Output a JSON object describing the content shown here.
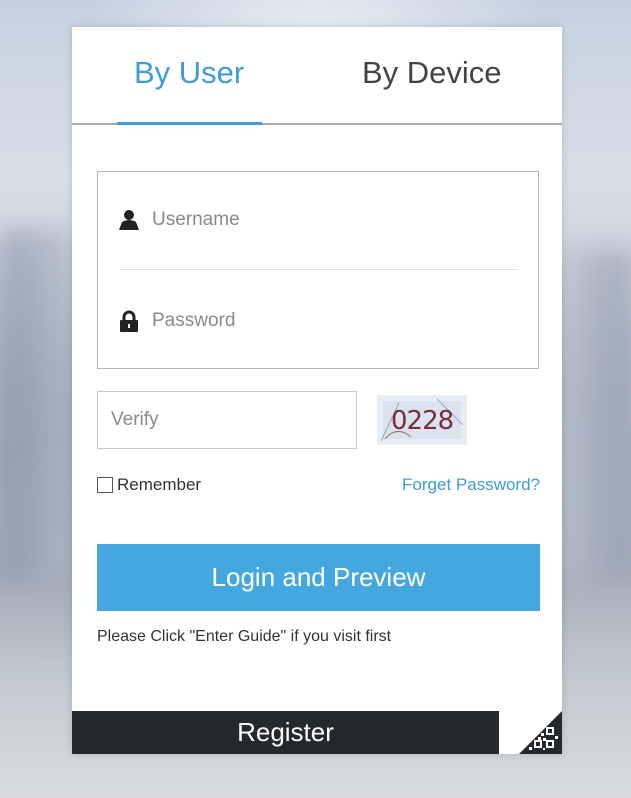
{
  "tabs": [
    {
      "label": "By User",
      "active": true
    },
    {
      "label": "By Device",
      "active": false
    }
  ],
  "username": {
    "placeholder": "Username",
    "icon": "user-icon"
  },
  "password": {
    "placeholder": "Password",
    "icon": "lock-icon"
  },
  "verify": {
    "placeholder": "Verify",
    "captcha_text": "0228"
  },
  "remember": {
    "label": "Remember",
    "checked": false
  },
  "forgot_password": "Forget Password?",
  "login_button": "Login and Preview",
  "hint": "Please Click \"Enter Guide\" if you visit first",
  "register_button": "Register",
  "qr_icon": "qr-code-icon",
  "colors": {
    "accent": "#45a7df",
    "tab_active": "#3e9dd8",
    "register_bg": "#25292b"
  }
}
